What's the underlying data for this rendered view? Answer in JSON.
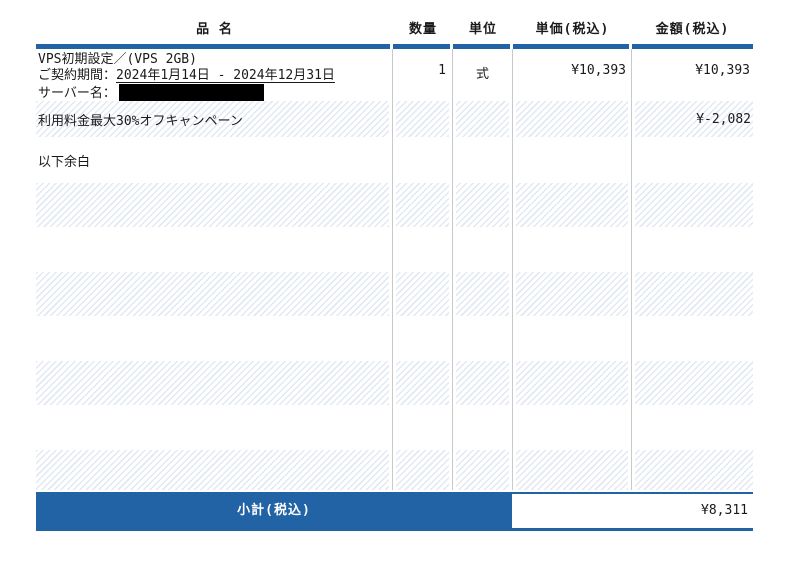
{
  "table": {
    "columns": [
      "品 名",
      "数量",
      "単位",
      "単価(税込)",
      "金額(税込)"
    ],
    "item_row": {
      "line1": "VPS初期設定／(VPS 2GB)",
      "line2_label": "ご契約期間：",
      "line2_period": "2024年1月14日 - 2024年12月31日",
      "line3_label": "サーバー名：",
      "server_name_redacted": true,
      "qty": "1",
      "unit": "式",
      "unit_price": "¥10,393",
      "amount": "¥10,393"
    },
    "campaign_row": {
      "name": "利用料金最大30%オフキャンペーン",
      "amount": "¥-2,082"
    },
    "blank_row": {
      "name": "以下余白"
    },
    "empty_row_count": 7,
    "footer": {
      "label": "小計(税込)",
      "amount": "¥8,311"
    }
  },
  "colors": {
    "accent_blue": "#2163a5",
    "stripe_blue": "#e2e9f3",
    "grid_line": "#c9c9c9",
    "text": "#1a1a1a",
    "redaction": "#000000"
  }
}
